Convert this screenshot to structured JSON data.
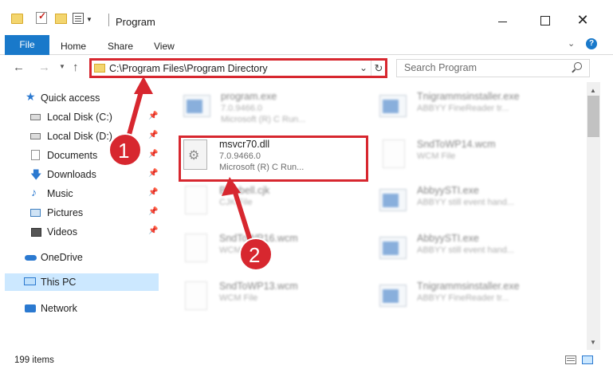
{
  "window": {
    "title": "Program",
    "colors": {
      "accent": "#1979ca",
      "highlight": "#d7272f",
      "selection": "#cce8ff"
    }
  },
  "quick_access_toolbar": {
    "icons": [
      "folder-icon",
      "properties-check-icon",
      "new-folder-icon",
      "customize-icon",
      "dropdown-icon"
    ]
  },
  "window_controls": {
    "close_glyph": "✕"
  },
  "ribbon": {
    "tabs": [
      {
        "label": "File"
      },
      {
        "label": "Home"
      },
      {
        "label": "Share"
      },
      {
        "label": "View"
      }
    ],
    "help": "?"
  },
  "navigation": {
    "back": "←",
    "forward": "→",
    "recent": "⌄",
    "up": "↑",
    "address": "C:\\Program Files\\Program Directory",
    "refresh": "↻",
    "dropdown": "⌄",
    "search_placeholder": "Search Program"
  },
  "sidebar": {
    "items": [
      {
        "label": "Quick access",
        "icon": "star-icon",
        "glyph": "★",
        "pinned": false
      },
      {
        "label": "Local Disk (C:)",
        "icon": "drive-icon",
        "pinned": true
      },
      {
        "label": "Local Disk (D:)",
        "icon": "drive-icon",
        "pinned": true
      },
      {
        "label": "Documents",
        "icon": "document-icon",
        "pinned": true
      },
      {
        "label": "Downloads",
        "icon": "download-icon",
        "glyph": "🡇",
        "pinned": true
      },
      {
        "label": "Music",
        "icon": "music-icon",
        "glyph": "♪",
        "pinned": true
      },
      {
        "label": "Pictures",
        "icon": "pictures-icon",
        "pinned": true
      },
      {
        "label": "Videos",
        "icon": "videos-icon",
        "pinned": true
      },
      {
        "label": "OneDrive",
        "icon": "cloud-icon",
        "pinned": false
      },
      {
        "label": "This PC",
        "icon": "computer-icon",
        "pinned": false,
        "selected": true
      },
      {
        "label": "Network",
        "icon": "network-icon",
        "pinned": false
      }
    ],
    "pin_glyph": "📌"
  },
  "files": [
    {
      "name": "program.exe",
      "line2": "7.0.9466.0",
      "line3": "Microsoft (R) C Run...",
      "icon": "exe-icon",
      "faded": true
    },
    {
      "name": "Tnigrammsinstaller.exe",
      "line2": "ABBYY FineReader tr...",
      "line3": "",
      "icon": "exe-icon",
      "faded": true
    },
    {
      "name": "msvcr70.dll",
      "line2": "7.0.9466.0",
      "line3": "Microsoft (R) C Run...",
      "icon": "dll-gear-icon",
      "faded": false,
      "highlighted": true
    },
    {
      "name": "SndToWP14.wcm",
      "line2": "WCM File",
      "line3": "",
      "icon": "file-icon",
      "faded": true
    },
    {
      "name": "Bluebell.cjk",
      "line2": "CJK File",
      "line3": "",
      "icon": "file-icon",
      "faded": true
    },
    {
      "name": "AbbyySTI.exe",
      "line2": "ABBYY still event hand...",
      "line3": "",
      "icon": "exe-icon",
      "faded": true
    },
    {
      "name": "SndToWP16.wcm",
      "line2": "WCM File",
      "line3": "",
      "icon": "file-icon",
      "faded": true
    },
    {
      "name": "AbbyySTI.exe",
      "line2": "ABBYY still event hand...",
      "line3": "",
      "icon": "exe-icon",
      "faded": true
    },
    {
      "name": "SndToWP13.wcm",
      "line2": "WCM File",
      "line3": "",
      "icon": "file-icon",
      "faded": true
    },
    {
      "name": "Tnigrammsinstaller.exe",
      "line2": "ABBYY FineReader tr...",
      "line3": "",
      "icon": "exe-icon",
      "faded": true
    }
  ],
  "scrollbar": {
    "up": "▲",
    "down": "▼"
  },
  "status": {
    "item_count": "199 items"
  },
  "annotations": [
    {
      "number": "1",
      "target": "address-bar"
    },
    {
      "number": "2",
      "target": "msvcr70.dll"
    }
  ]
}
